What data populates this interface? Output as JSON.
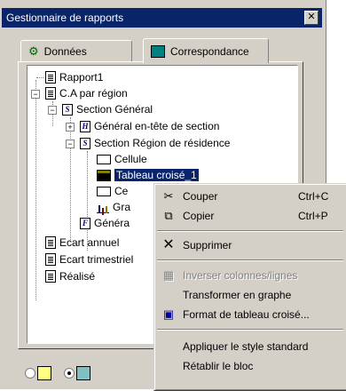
{
  "window": {
    "title": "Gestionnaire de rapports",
    "close": "✕"
  },
  "tabs": [
    {
      "label": "Données"
    },
    {
      "label": "Correspondance"
    }
  ],
  "tree": {
    "items": [
      "Rapport1",
      "C.A par région",
      "Section Général",
      "Général en-tête de section",
      "Section Région de résidence",
      "Cellule",
      "Tableau croisé_1",
      "Ce",
      "Gra",
      "Généra",
      "Ecart annuel",
      "Ecart trimestriel",
      "Réalisé"
    ]
  },
  "context_menu": {
    "items": [
      {
        "label": "Couper",
        "shortcut": "Ctrl+C",
        "icon": "scissors-icon"
      },
      {
        "label": "Copier",
        "shortcut": "Ctrl+P",
        "icon": "copy-icon"
      },
      {
        "label": "Supprimer",
        "icon": "delete-icon"
      },
      {
        "label": "Inverser colonnes/lignes",
        "disabled": true,
        "icon": "swap-icon"
      },
      {
        "label": "Transformer en graphe"
      },
      {
        "label": "Format de tableau croisé...",
        "icon": "format-icon"
      },
      {
        "label": "Appliquer le style standard"
      },
      {
        "label": "Rétablir le bloc"
      }
    ]
  },
  "colors": {
    "titlebar": "#0a246a",
    "face": "#d4d0c8",
    "selection": "#0a246a"
  }
}
